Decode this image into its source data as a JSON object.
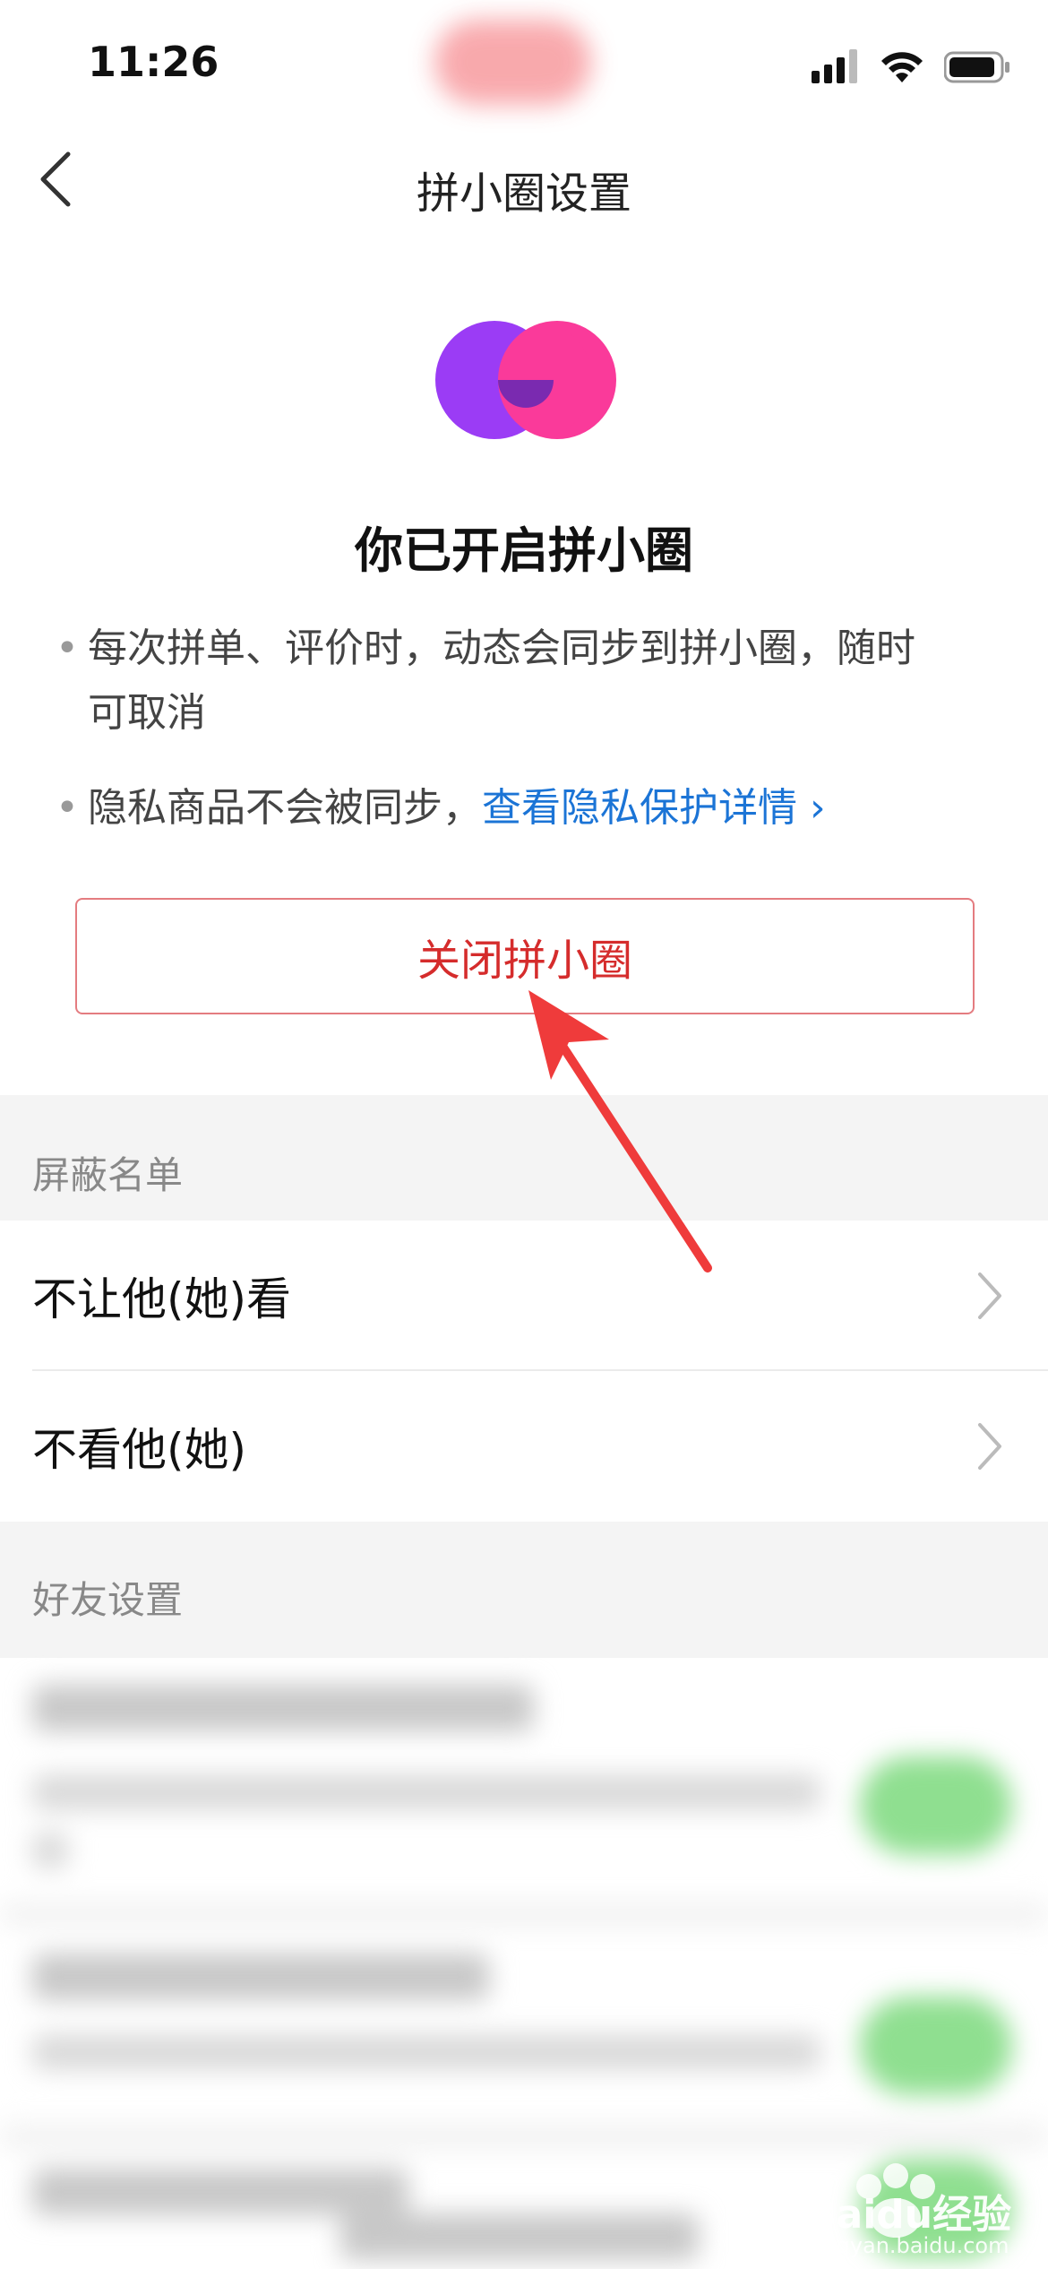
{
  "status_bar": {
    "time": "11:26"
  },
  "nav": {
    "title": "拼小圈设置"
  },
  "hero": {
    "title": "你已开启拼小圈",
    "bullets": {
      "b1_line1": "每次拼单、评价时，动态会同步到拼小圈，随时",
      "b1_line2": "可取消",
      "b2_text": "隐私商品不会被同步，",
      "b2_link": "查看隐私保护详情 ›"
    },
    "close_button": "关闭拼小圈"
  },
  "block_list": {
    "header": "屏蔽名单",
    "items": [
      "不让他(她)看",
      "不看他(她)"
    ]
  },
  "friend_settings": {
    "header": "好友设置"
  },
  "watermark": {
    "text": "Baidu经验",
    "sub": "jingyan.baidu.com"
  },
  "colors": {
    "accent_red": "#d52c2c",
    "link_blue": "#1b74d6",
    "logo_purple": "#9b3cf5",
    "logo_pink": "#fa3a9a"
  }
}
